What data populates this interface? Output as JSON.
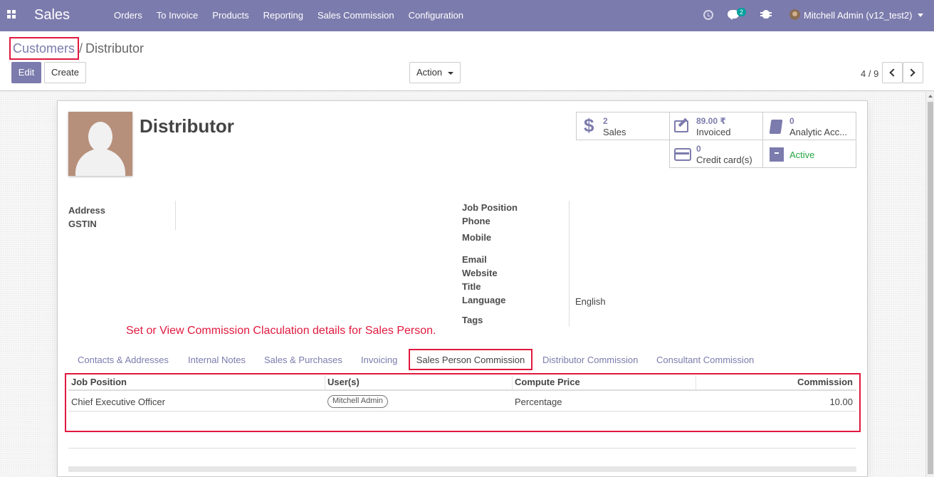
{
  "navbar": {
    "brand": "Sales",
    "menu": [
      "Orders",
      "To Invoice",
      "Products",
      "Reporting",
      "Sales Commission",
      "Configuration"
    ],
    "chat_count": "2",
    "user": "Mitchell Admin (v12_test2)"
  },
  "breadcrumb": {
    "parent": "Customers",
    "separator": "/",
    "current": "Distributor"
  },
  "buttons": {
    "edit": "Edit",
    "create": "Create",
    "action": "Action"
  },
  "pager": {
    "value": "4 / 9"
  },
  "partner": {
    "name": "Distributor"
  },
  "stats": {
    "sales": {
      "value": "2",
      "label": "Sales"
    },
    "invoiced": {
      "value": "89.00 ₹",
      "label": "Invoiced"
    },
    "analytic": {
      "value": "0",
      "label": "Analytic Acc..."
    },
    "credit": {
      "value": "0",
      "label": "Credit card(s)"
    },
    "active": {
      "label": "Active"
    }
  },
  "fields": {
    "address": "Address",
    "gstin": "GSTIN",
    "job_position": "Job Position",
    "phone": "Phone",
    "mobile": "Mobile",
    "email": "Email",
    "website": "Website",
    "title": "Title",
    "language": "Language",
    "language_value": "English",
    "tags": "Tags"
  },
  "help_text": "Set or View Commission Claculation details for Sales Person.",
  "tabs": [
    "Contacts & Addresses",
    "Internal Notes",
    "Sales & Purchases",
    "Invoicing",
    "Sales Person Commission",
    "Distributor Commission",
    "Consultant Commission"
  ],
  "table": {
    "headers": [
      "Job Position",
      "User(s)",
      "Compute Price",
      "Commission"
    ],
    "rows": [
      {
        "job_position": "Chief Executive Officer",
        "user": "Mitchell Admin",
        "compute_price": "Percentage",
        "commission": "10.00"
      }
    ]
  },
  "colors": {
    "brand": "#7c7bad",
    "highlight": "#e0193e",
    "active": "#28a745"
  }
}
